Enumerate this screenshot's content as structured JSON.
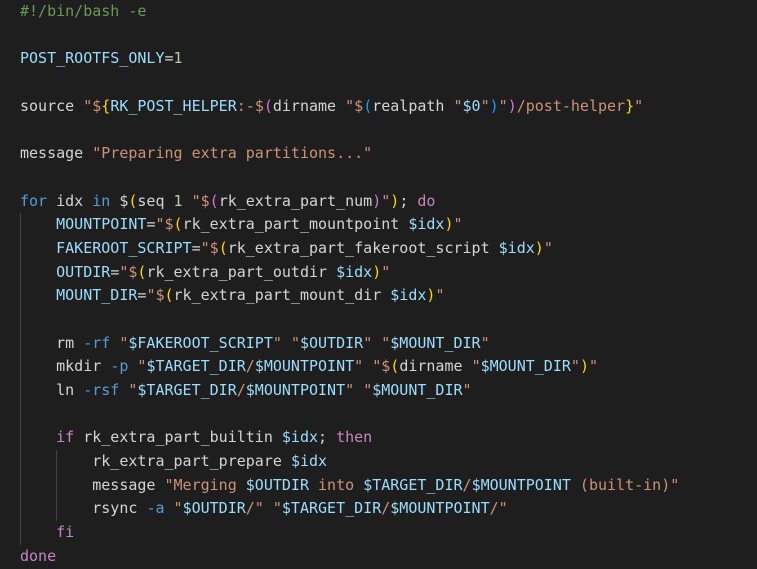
{
  "editor": {
    "language": "bash",
    "lines": [
      {
        "indent": 0,
        "tokens": [
          {
            "t": "#!/bin/bash -e",
            "c": "comment"
          }
        ]
      },
      {
        "indent": 0,
        "tokens": []
      },
      {
        "indent": 0,
        "tokens": [
          {
            "t": "POST_ROOTFS_ONLY",
            "c": "var"
          },
          {
            "t": "=",
            "c": "op"
          },
          {
            "t": "1",
            "c": "num"
          }
        ]
      },
      {
        "indent": 0,
        "tokens": []
      },
      {
        "indent": 0,
        "tokens": [
          {
            "t": "source ",
            "c": "plain"
          },
          {
            "t": "\"",
            "c": "str"
          },
          {
            "t": "$",
            "c": "str"
          },
          {
            "t": "{",
            "c": "brace1"
          },
          {
            "t": "RK_POST_HELPER",
            "c": "var"
          },
          {
            "t": ":-",
            "c": "str"
          },
          {
            "t": "$",
            "c": "str"
          },
          {
            "t": "(",
            "c": "brace2"
          },
          {
            "t": "dirname ",
            "c": "plain"
          },
          {
            "t": "\"",
            "c": "str"
          },
          {
            "t": "$",
            "c": "str"
          },
          {
            "t": "(",
            "c": "brace3"
          },
          {
            "t": "realpath ",
            "c": "plain"
          },
          {
            "t": "\"",
            "c": "str"
          },
          {
            "t": "$0",
            "c": "var"
          },
          {
            "t": "\"",
            "c": "str"
          },
          {
            "t": ")",
            "c": "brace3"
          },
          {
            "t": "\"",
            "c": "str"
          },
          {
            "t": ")",
            "c": "brace2"
          },
          {
            "t": "/post-helper",
            "c": "str"
          },
          {
            "t": "}",
            "c": "brace1"
          },
          {
            "t": "\"",
            "c": "str"
          }
        ]
      },
      {
        "indent": 0,
        "tokens": []
      },
      {
        "indent": 0,
        "tokens": [
          {
            "t": "message ",
            "c": "plain"
          },
          {
            "t": "\"Preparing extra partitions...\"",
            "c": "str"
          }
        ]
      },
      {
        "indent": 0,
        "tokens": []
      },
      {
        "indent": 0,
        "tokens": [
          {
            "t": "for ",
            "c": "ctl"
          },
          {
            "t": "idx ",
            "c": "plain"
          },
          {
            "t": "in ",
            "c": "ctl"
          },
          {
            "t": "$",
            "c": "plain"
          },
          {
            "t": "(",
            "c": "brace1"
          },
          {
            "t": "seq ",
            "c": "plain"
          },
          {
            "t": "1 ",
            "c": "num"
          },
          {
            "t": "\"$",
            "c": "str"
          },
          {
            "t": "(",
            "c": "brace2"
          },
          {
            "t": "rk_extra_part_num",
            "c": "plain"
          },
          {
            "t": ")",
            "c": "brace2"
          },
          {
            "t": "\"",
            "c": "str"
          },
          {
            "t": ")",
            "c": "brace1"
          },
          {
            "t": "; ",
            "c": "plain"
          },
          {
            "t": "do",
            "c": "kw"
          }
        ]
      },
      {
        "indent": 1,
        "tokens": [
          {
            "t": "MOUNTPOINT",
            "c": "var"
          },
          {
            "t": "=",
            "c": "op"
          },
          {
            "t": "\"$",
            "c": "str"
          },
          {
            "t": "(",
            "c": "brace1"
          },
          {
            "t": "rk_extra_part_mountpoint ",
            "c": "plain"
          },
          {
            "t": "$idx",
            "c": "var"
          },
          {
            "t": ")",
            "c": "brace1"
          },
          {
            "t": "\"",
            "c": "str"
          }
        ]
      },
      {
        "indent": 1,
        "tokens": [
          {
            "t": "FAKEROOT_SCRIPT",
            "c": "var"
          },
          {
            "t": "=",
            "c": "op"
          },
          {
            "t": "\"$",
            "c": "str"
          },
          {
            "t": "(",
            "c": "brace1"
          },
          {
            "t": "rk_extra_part_fakeroot_script ",
            "c": "plain"
          },
          {
            "t": "$idx",
            "c": "var"
          },
          {
            "t": ")",
            "c": "brace1"
          },
          {
            "t": "\"",
            "c": "str"
          }
        ]
      },
      {
        "indent": 1,
        "tokens": [
          {
            "t": "OUTDIR",
            "c": "var"
          },
          {
            "t": "=",
            "c": "op"
          },
          {
            "t": "\"$",
            "c": "str"
          },
          {
            "t": "(",
            "c": "brace1"
          },
          {
            "t": "rk_extra_part_outdir ",
            "c": "plain"
          },
          {
            "t": "$idx",
            "c": "var"
          },
          {
            "t": ")",
            "c": "brace1"
          },
          {
            "t": "\"",
            "c": "str"
          }
        ]
      },
      {
        "indent": 1,
        "tokens": [
          {
            "t": "MOUNT_DIR",
            "c": "var"
          },
          {
            "t": "=",
            "c": "op"
          },
          {
            "t": "\"$",
            "c": "str"
          },
          {
            "t": "(",
            "c": "brace1"
          },
          {
            "t": "rk_extra_part_mount_dir ",
            "c": "plain"
          },
          {
            "t": "$idx",
            "c": "var"
          },
          {
            "t": ")",
            "c": "brace1"
          },
          {
            "t": "\"",
            "c": "str"
          }
        ]
      },
      {
        "indent": 1,
        "tokens": []
      },
      {
        "indent": 1,
        "tokens": [
          {
            "t": "rm ",
            "c": "plain"
          },
          {
            "t": "-rf ",
            "c": "flag"
          },
          {
            "t": "\"",
            "c": "str"
          },
          {
            "t": "$FAKEROOT_SCRIPT",
            "c": "var"
          },
          {
            "t": "\" ",
            "c": "str"
          },
          {
            "t": "\"",
            "c": "str"
          },
          {
            "t": "$OUTDIR",
            "c": "var"
          },
          {
            "t": "\" ",
            "c": "str"
          },
          {
            "t": "\"",
            "c": "str"
          },
          {
            "t": "$MOUNT_DIR",
            "c": "var"
          },
          {
            "t": "\"",
            "c": "str"
          }
        ]
      },
      {
        "indent": 1,
        "tokens": [
          {
            "t": "mkdir ",
            "c": "plain"
          },
          {
            "t": "-p ",
            "c": "flag"
          },
          {
            "t": "\"",
            "c": "str"
          },
          {
            "t": "$TARGET_DIR",
            "c": "var"
          },
          {
            "t": "/",
            "c": "str"
          },
          {
            "t": "$MOUNTPOINT",
            "c": "var"
          },
          {
            "t": "\" ",
            "c": "str"
          },
          {
            "t": "\"$",
            "c": "str"
          },
          {
            "t": "(",
            "c": "brace1"
          },
          {
            "t": "dirname ",
            "c": "plain"
          },
          {
            "t": "\"",
            "c": "str"
          },
          {
            "t": "$MOUNT_DIR",
            "c": "var"
          },
          {
            "t": "\"",
            "c": "str"
          },
          {
            "t": ")",
            "c": "brace1"
          },
          {
            "t": "\"",
            "c": "str"
          }
        ]
      },
      {
        "indent": 1,
        "tokens": [
          {
            "t": "ln ",
            "c": "plain"
          },
          {
            "t": "-rsf ",
            "c": "flag"
          },
          {
            "t": "\"",
            "c": "str"
          },
          {
            "t": "$TARGET_DIR",
            "c": "var"
          },
          {
            "t": "/",
            "c": "str"
          },
          {
            "t": "$MOUNTPOINT",
            "c": "var"
          },
          {
            "t": "\" ",
            "c": "str"
          },
          {
            "t": "\"",
            "c": "str"
          },
          {
            "t": "$MOUNT_DIR",
            "c": "var"
          },
          {
            "t": "\"",
            "c": "str"
          }
        ]
      },
      {
        "indent": 1,
        "tokens": []
      },
      {
        "indent": 1,
        "tokens": [
          {
            "t": "if ",
            "c": "kw"
          },
          {
            "t": "rk_extra_part_builtin ",
            "c": "plain"
          },
          {
            "t": "$idx",
            "c": "var"
          },
          {
            "t": "; ",
            "c": "plain"
          },
          {
            "t": "then",
            "c": "kw"
          }
        ]
      },
      {
        "indent": 2,
        "tokens": [
          {
            "t": "rk_extra_part_prepare ",
            "c": "plain"
          },
          {
            "t": "$idx",
            "c": "var"
          }
        ]
      },
      {
        "indent": 2,
        "tokens": [
          {
            "t": "message ",
            "c": "plain"
          },
          {
            "t": "\"Merging ",
            "c": "str"
          },
          {
            "t": "$OUTDIR",
            "c": "var"
          },
          {
            "t": " into ",
            "c": "str"
          },
          {
            "t": "$TARGET_DIR",
            "c": "var"
          },
          {
            "t": "/",
            "c": "str"
          },
          {
            "t": "$MOUNTPOINT",
            "c": "var"
          },
          {
            "t": " (built-in)\"",
            "c": "str"
          }
        ]
      },
      {
        "indent": 2,
        "tokens": [
          {
            "t": "rsync ",
            "c": "plain"
          },
          {
            "t": "-a ",
            "c": "flag"
          },
          {
            "t": "\"",
            "c": "str"
          },
          {
            "t": "$OUTDIR",
            "c": "var"
          },
          {
            "t": "/\" ",
            "c": "str"
          },
          {
            "t": "\"",
            "c": "str"
          },
          {
            "t": "$TARGET_DIR",
            "c": "var"
          },
          {
            "t": "/",
            "c": "str"
          },
          {
            "t": "$MOUNTPOINT",
            "c": "var"
          },
          {
            "t": "/\"",
            "c": "str"
          }
        ]
      },
      {
        "indent": 1,
        "tokens": [
          {
            "t": "fi",
            "c": "kw"
          }
        ]
      },
      {
        "indent": 0,
        "tokens": [
          {
            "t": "done",
            "c": "kw"
          }
        ]
      }
    ]
  },
  "colors": {
    "background": "#1e1e1e",
    "comment": "#6a9955",
    "variable": "#9cdcfe",
    "string": "#ce9178",
    "keyword": "#c586c0",
    "control": "#569cd6",
    "number": "#b5cea8",
    "plain": "#d4d4d4"
  }
}
